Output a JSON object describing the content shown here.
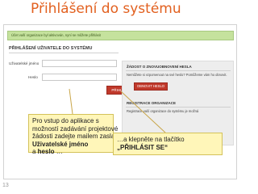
{
  "slide": {
    "title": "Přihlášení do systému",
    "page_number": "13"
  },
  "screenshot": {
    "notice": "Účet vaší organizace byl aktivován, nyní se můžete přihlásit",
    "login": {
      "heading": "PŘIHLÁŠENÍ UŽIVATELE DO SYSTÉMU",
      "username_label": "Uživatelské jméno",
      "password_label": "Heslo",
      "username_value": "",
      "password_value": "",
      "submit_label": "PŘIHLÁSIT"
    },
    "forgot": {
      "heading": "ŽÁDOST O ZNOVUOBNOVENÍ HESLA",
      "text": "Nemůžete si vzpomenout na své heslo? Pomůžeme vám ho obnovit.",
      "button_label": "OBNOVIT HESLO"
    },
    "registration": {
      "heading": "REGISTRACE ORGANIZACE",
      "text": "Registrace vaší organizace do systému je možná"
    }
  },
  "callouts": {
    "left": {
      "line1": "Pro vstup do aplikace s",
      "line2": "možností zadávání projektové",
      "line3": "žádosti zadejte mailem zaslané",
      "bold1": "Uživatelské jméno",
      "prefix5": "a ",
      "bold2": "heslo",
      "suffix5": " …"
    },
    "right": {
      "line1": "…a klepněte na tlačítko",
      "bold": "„PŘIHLÁSIT SE“"
    }
  },
  "colors": {
    "title": "#e2601f",
    "button": "#c0392b",
    "notice_bg": "#c5e29d",
    "callout_bg": "#fff6b9",
    "panel_bg": "#ededed"
  }
}
